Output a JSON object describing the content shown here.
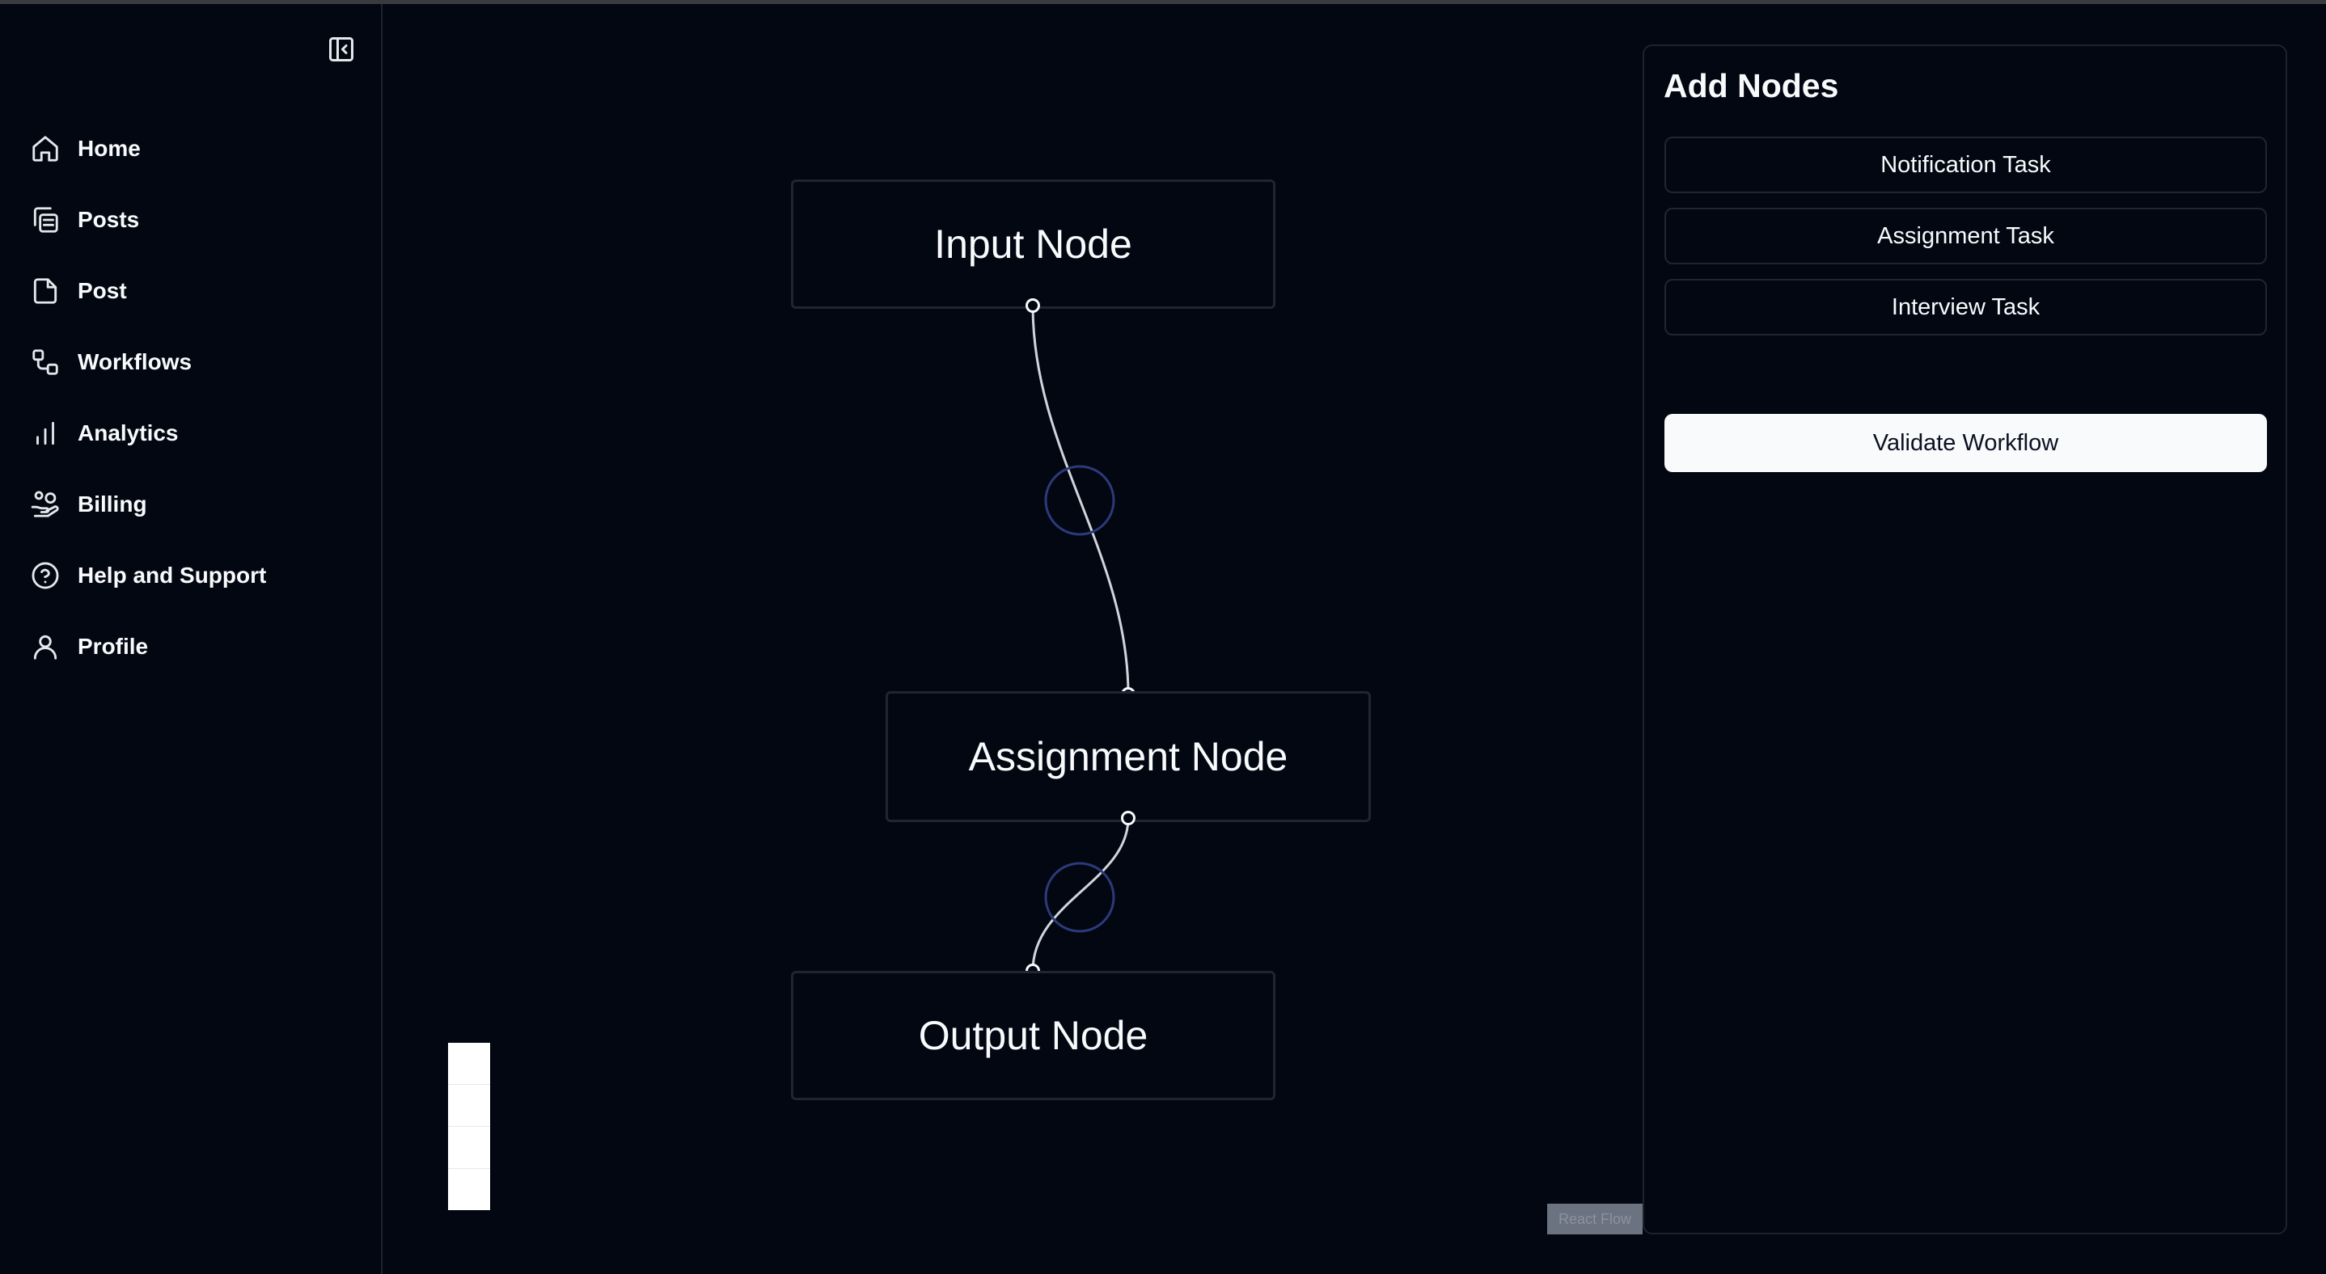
{
  "sidebar": {
    "collapse_icon": "panel-left-close-icon",
    "items": [
      {
        "label": "Home",
        "icon": "home-icon"
      },
      {
        "label": "Posts",
        "icon": "copy-icon"
      },
      {
        "label": "Post",
        "icon": "file-icon"
      },
      {
        "label": "Workflows",
        "icon": "workflow-icon"
      },
      {
        "label": "Analytics",
        "icon": "bar-chart-icon"
      },
      {
        "label": "Billing",
        "icon": "hand-coins-icon"
      },
      {
        "label": "Help and Support",
        "icon": "help-circle-icon"
      },
      {
        "label": "Profile",
        "icon": "user-icon"
      }
    ]
  },
  "canvas": {
    "nodes": {
      "input": "Input Node",
      "assignment": "Assignment Node",
      "output": "Output Node"
    },
    "attribution": "React Flow"
  },
  "panel": {
    "title": "Add Nodes",
    "tasks": [
      "Notification Task",
      "Assignment Task",
      "Interview Task"
    ],
    "validate_label": "Validate Workflow"
  },
  "colors": {
    "background": "#030712",
    "edge": "#d1d5db",
    "edge_marker": "#2b3a7a",
    "button_primary_bg": "#f8fafc"
  }
}
